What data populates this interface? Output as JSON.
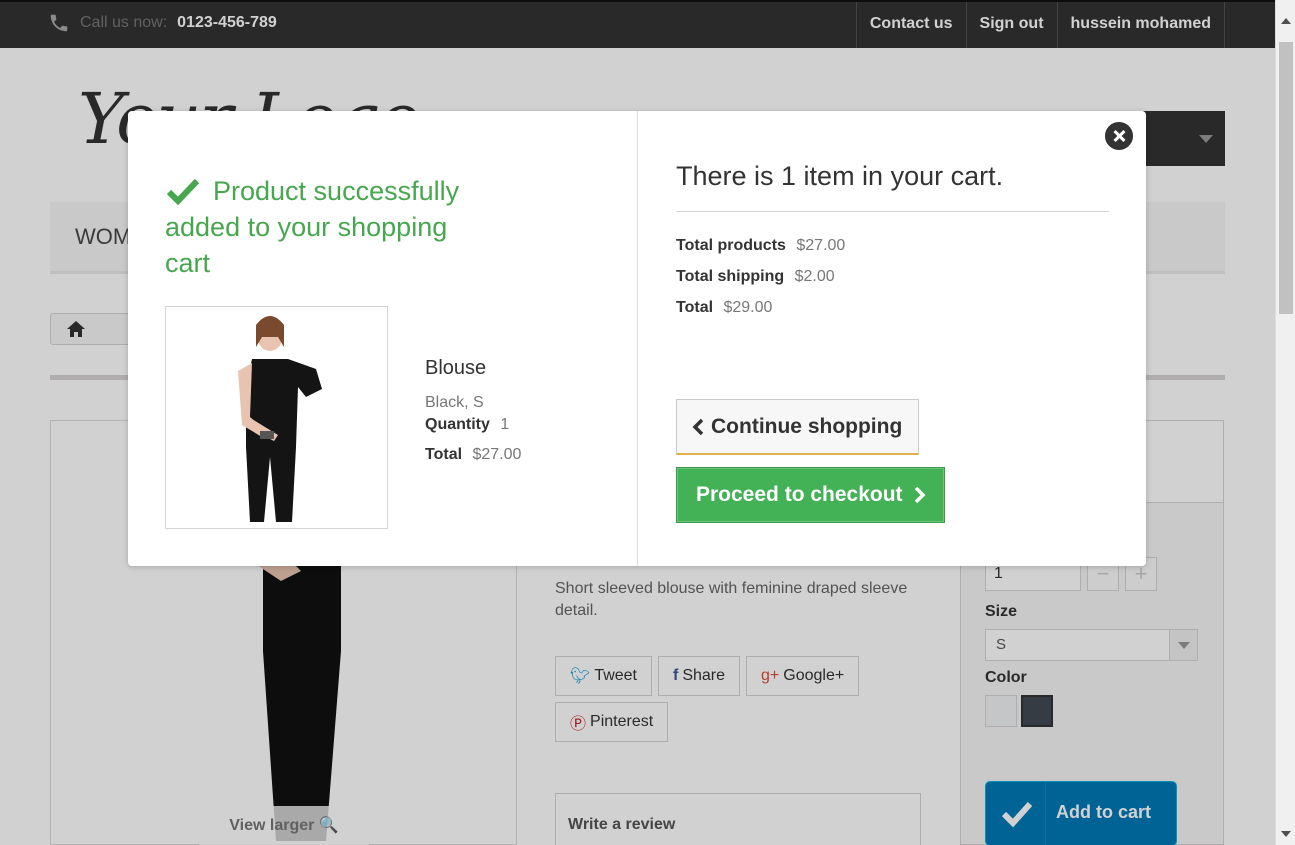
{
  "topbar": {
    "call_label": "Call us now:",
    "phone": "0123-456-789",
    "links": [
      "Contact us",
      "Sign out",
      "hussein mohamed"
    ]
  },
  "header": {
    "logo_text": "Your Logo",
    "menu_item": "WOM"
  },
  "product_page": {
    "view_larger": "View larger",
    "description": "Short sleeved blouse with feminine draped sleeve detail.",
    "social": [
      "Tweet",
      "Share",
      "Google+",
      "Pinterest"
    ],
    "review_label": "Write a review",
    "quantity_value": "1",
    "size_label": "Size",
    "size_selected": "S",
    "color_label": "Color",
    "add_to_cart": "Add to cart"
  },
  "modal": {
    "success_title": "Product successfully added to your shopping cart",
    "product": {
      "name": "Blouse",
      "attributes": "Black, S",
      "quantity_label": "Quantity",
      "quantity": "1",
      "total_label": "Total",
      "total": "$27.00"
    },
    "cart_count_text": "There is 1 item in your cart.",
    "summary": {
      "products_label": "Total products",
      "products_value": "$27.00",
      "shipping_label": "Total shipping",
      "shipping_value": "$2.00",
      "total_label": "Total",
      "total_value": "$29.00"
    },
    "continue_label": "Continue shopping",
    "checkout_label": "Proceed to checkout"
  },
  "colors": {
    "success_green": "#46a74e",
    "checkout_green": "#43b155",
    "topbar_bg": "#333333",
    "add_cart_blue": "#0079b6"
  }
}
